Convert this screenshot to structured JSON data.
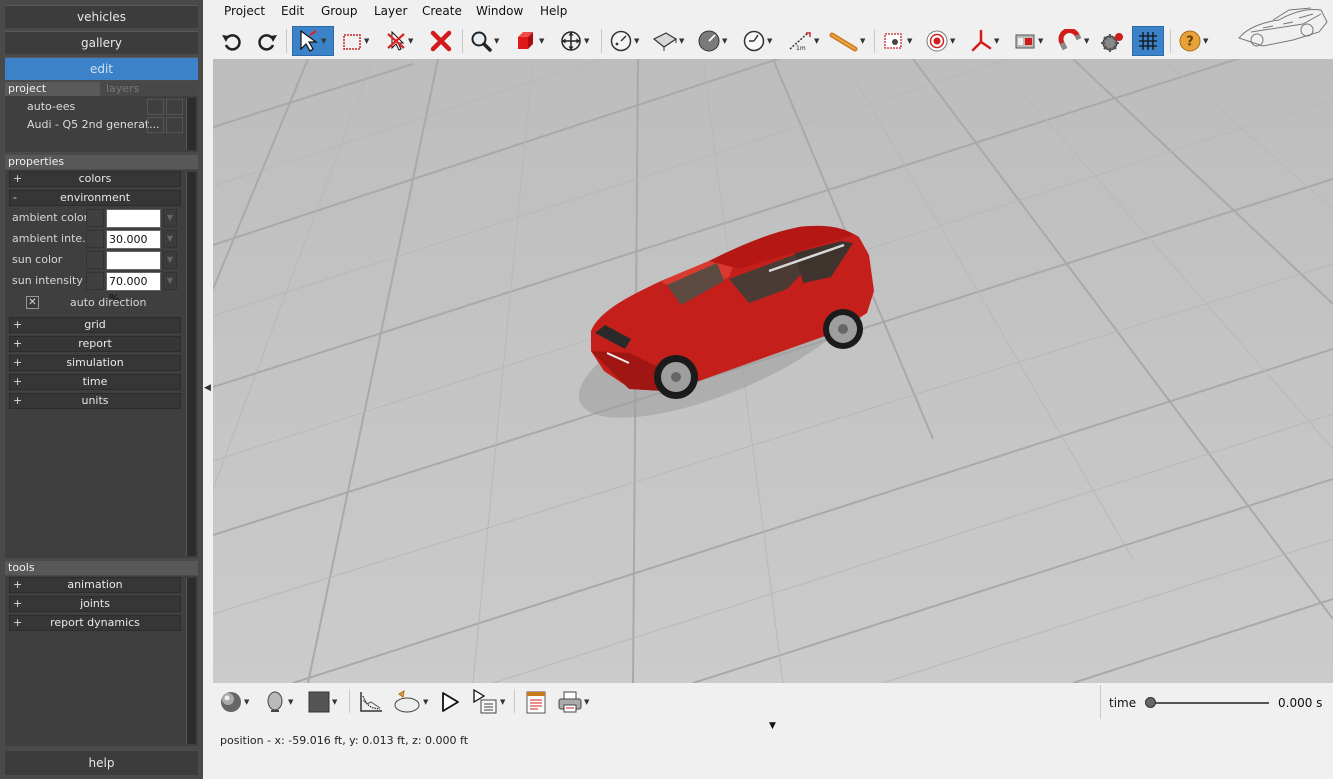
{
  "nav": {
    "vehicles": "vehicles",
    "gallery": "gallery",
    "edit": "edit",
    "help": "help"
  },
  "project_panel": {
    "tabs": [
      "project",
      "layers"
    ],
    "items": [
      "auto-ees",
      "Audi - Q5 2nd generat..."
    ]
  },
  "properties": {
    "header": "properties",
    "groups": {
      "colors": {
        "sign": "+",
        "label": "colors"
      },
      "environment": {
        "sign": "-",
        "label": "environment"
      },
      "grid": {
        "sign": "+",
        "label": "grid"
      },
      "report": {
        "sign": "+",
        "label": "report"
      },
      "simulation": {
        "sign": "+",
        "label": "simulation"
      },
      "time": {
        "sign": "+",
        "label": "time"
      },
      "units": {
        "sign": "+",
        "label": "units"
      }
    },
    "environment": {
      "ambient_color_label": "ambient color",
      "ambient_color": "#ffffff",
      "ambient_intensity_label": "ambient inte...",
      "ambient_intensity": "30.000 %",
      "sun_color_label": "sun color",
      "sun_color": "#ffffff",
      "sun_intensity_label": "sun intensity",
      "sun_intensity": "70.000 %",
      "auto_direction_label": "auto direction",
      "auto_direction_checked": true
    }
  },
  "tools": {
    "header": "tools",
    "groups": [
      {
        "sign": "+",
        "label": "animation"
      },
      {
        "sign": "+",
        "label": "joints"
      },
      {
        "sign": "+",
        "label": "report dynamics"
      }
    ]
  },
  "menu": [
    "Project",
    "Edit",
    "Group",
    "Layer",
    "Create",
    "Window",
    "Help"
  ],
  "toolbar_icons": [
    "undo-icon",
    "redo-icon",
    "select-arrow-icon",
    "selection-box-icon",
    "deselect-icon",
    "delete-icon",
    "zoom-icon",
    "solid-view-icon",
    "move-icon",
    "rotate-dial-icon",
    "surface-icon",
    "measure-dial-icon",
    "angle-dial-icon",
    "ruler-icon",
    "tape-icon",
    "snapshot-icon",
    "target-icon",
    "axis-icon",
    "camera-icon",
    "magnet-icon",
    "settings-icon",
    "grid-icon",
    "help-icon"
  ],
  "time": {
    "label": "time",
    "value": "0.000 s",
    "position": 0
  },
  "status": "position - x: -59.016 ft, y: 0.013 ft, z: 0.000 ft",
  "colors": {
    "accent": "#3c82c8",
    "panel": "#4a4a4a",
    "viewport": "#c6c6c6",
    "vehicle": "#c8201c"
  }
}
